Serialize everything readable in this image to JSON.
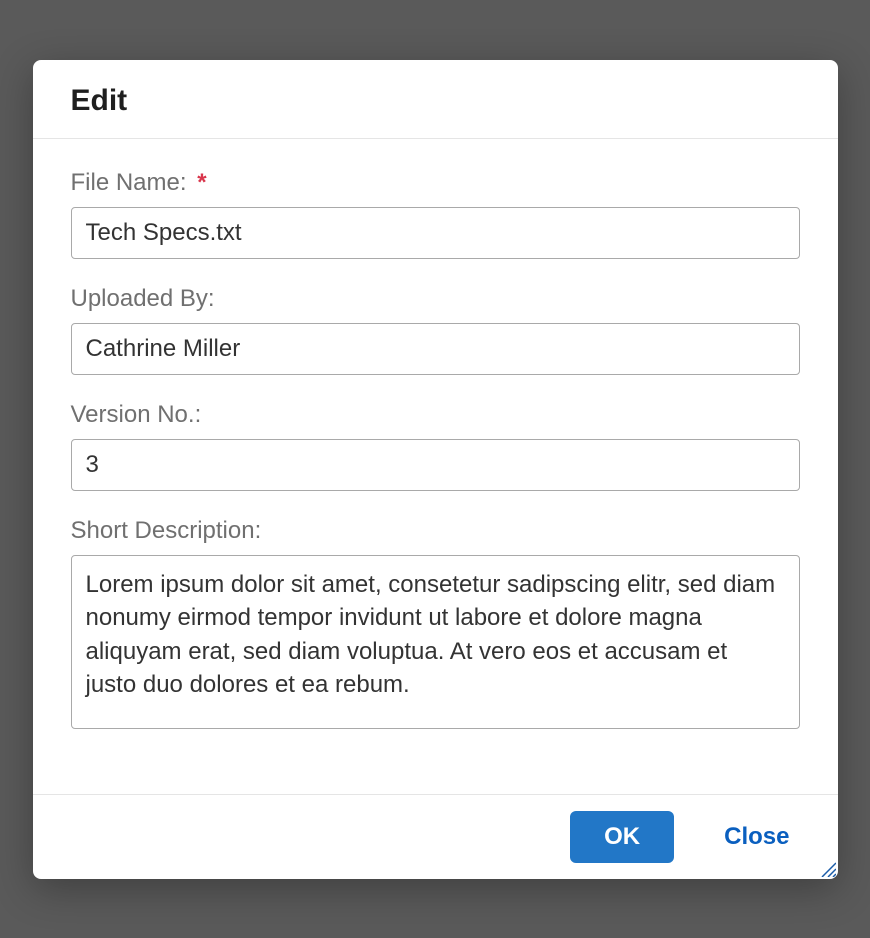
{
  "dialog": {
    "title": "Edit",
    "fields": {
      "file_name": {
        "label": "File Name:",
        "required": true,
        "value": "Tech Specs.txt"
      },
      "uploaded_by": {
        "label": "Uploaded By:",
        "required": false,
        "value": "Cathrine Miller"
      },
      "version_no": {
        "label": "Version No.:",
        "required": false,
        "value": "3"
      },
      "short_description": {
        "label": "Short Description:",
        "required": false,
        "value": "Lorem ipsum dolor sit amet, consetetur sadipscing elitr, sed diam nonumy eirmod tempor invidunt ut labore et dolore magna aliquyam erat, sed diam voluptua. At vero eos et accusam et justo duo dolores et ea rebum."
      }
    },
    "buttons": {
      "ok": "OK",
      "close": "Close"
    },
    "required_marker": "*"
  }
}
